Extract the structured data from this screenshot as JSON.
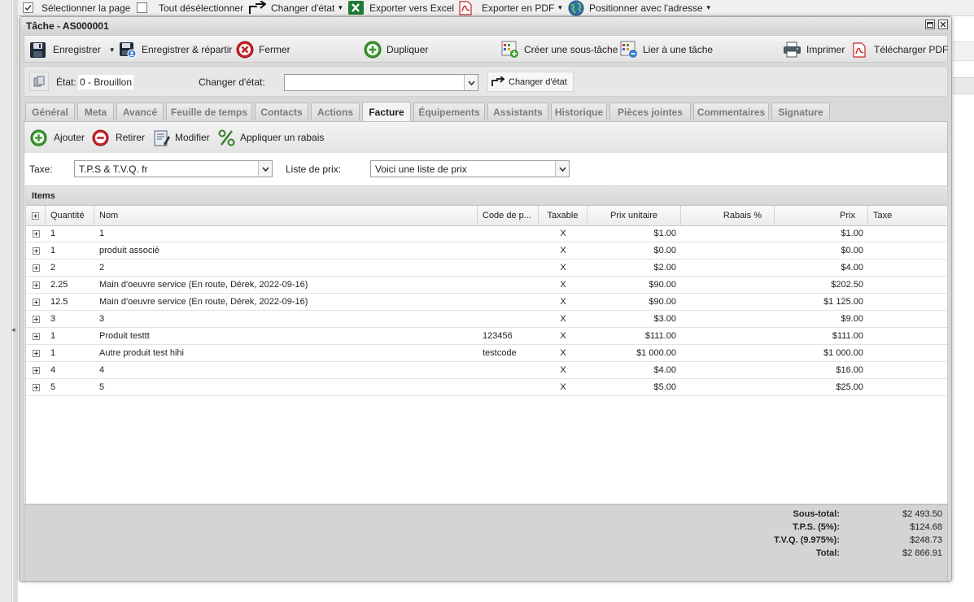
{
  "background_toolbar": {
    "select_page": "Sélectionner la page",
    "deselect_all": "Tout désélectionner",
    "change_state": "Changer d'état",
    "export_excel": "Exporter vers Excel",
    "export_pdf": "Exporter en PDF",
    "position_address": "Positionner avec l'adresse"
  },
  "window": {
    "title": "Tâche - AS000001"
  },
  "toolbar": {
    "save": "Enregistrer",
    "save_assign": "Enregistrer & répartir",
    "close": "Fermer",
    "duplicate": "Dupliquer",
    "create_subtask": "Créer une sous-tâche",
    "link_task": "Lier à une tâche",
    "print": "Imprimer",
    "download_pdf": "Télécharger PDF"
  },
  "state": {
    "label": "État:",
    "value": "0 - Brouillon",
    "change_label": "Changer d'état:",
    "change_value": "",
    "change_button": "Changer d'état"
  },
  "tabs": [
    {
      "label": "Général"
    },
    {
      "label": "Meta"
    },
    {
      "label": "Avancé"
    },
    {
      "label": "Feuille de temps"
    },
    {
      "label": "Contacts"
    },
    {
      "label": "Actions"
    },
    {
      "label": "Facture"
    },
    {
      "label": "Équipements"
    },
    {
      "label": "Assistants"
    },
    {
      "label": "Historique"
    },
    {
      "label": "Pièces jointes"
    },
    {
      "label": "Commentaires"
    },
    {
      "label": "Signature"
    }
  ],
  "active_tab": "Facture",
  "invoice_toolbar": {
    "add": "Ajouter",
    "remove": "Retirer",
    "edit": "Modifier",
    "discount": "Appliquer un rabais"
  },
  "tax": {
    "label": "Taxe:",
    "value": "T.P.S & T.V.Q. fr",
    "price_list_label": "Liste de prix:",
    "price_list_value": "Voici une liste de prix"
  },
  "grid": {
    "title": "Items",
    "columns": [
      "Quantité",
      "Nom",
      "Code de p...",
      "Taxable",
      "Prix unitaire",
      "Rabais %",
      "Prix",
      "Taxe"
    ],
    "rows": [
      {
        "qty": "1",
        "name": "1",
        "code": "",
        "taxable": "X",
        "unit": "$1.00",
        "discount": "",
        "price": "$1.00",
        "tax": ""
      },
      {
        "qty": "1",
        "name": "produit associé",
        "code": "",
        "taxable": "X",
        "unit": "$0.00",
        "discount": "",
        "price": "$0.00",
        "tax": ""
      },
      {
        "qty": "2",
        "name": "2",
        "code": "",
        "taxable": "X",
        "unit": "$2.00",
        "discount": "",
        "price": "$4.00",
        "tax": ""
      },
      {
        "qty": "2.25",
        "name": "Main d'oeuvre service (En route, Dérek, 2022-09-16)",
        "code": "",
        "taxable": "X",
        "unit": "$90.00",
        "discount": "",
        "price": "$202.50",
        "tax": ""
      },
      {
        "qty": "12.5",
        "name": "Main d'oeuvre service (En route, Dérek, 2022-09-16)",
        "code": "",
        "taxable": "X",
        "unit": "$90.00",
        "discount": "",
        "price": "$1 125.00",
        "tax": ""
      },
      {
        "qty": "3",
        "name": "3",
        "code": "",
        "taxable": "X",
        "unit": "$3.00",
        "discount": "",
        "price": "$9.00",
        "tax": ""
      },
      {
        "qty": "1",
        "name": "Produit testtt",
        "code": "123456",
        "taxable": "X",
        "unit": "$111.00",
        "discount": "",
        "price": "$111.00",
        "tax": ""
      },
      {
        "qty": "1",
        "name": "Autre produit test hihi",
        "code": "testcode",
        "taxable": "X",
        "unit": "$1 000.00",
        "discount": "",
        "price": "$1 000.00",
        "tax": ""
      },
      {
        "qty": "4",
        "name": "4",
        "code": "",
        "taxable": "X",
        "unit": "$4.00",
        "discount": "",
        "price": "$16.00",
        "tax": ""
      },
      {
        "qty": "5",
        "name": "5",
        "code": "",
        "taxable": "X",
        "unit": "$5.00",
        "discount": "",
        "price": "$25.00",
        "tax": ""
      }
    ]
  },
  "totals": [
    {
      "label": "Sous-total:",
      "value": "$2 493.50"
    },
    {
      "label": "T.P.S. (5%):",
      "value": "$124.68"
    },
    {
      "label": "T.V.Q. (9.975%):",
      "value": "$248.73"
    },
    {
      "label": "Total:",
      "value": "$2 866.91"
    }
  ],
  "icons": {
    "save": "floppy-icon",
    "close": "close-circle-icon",
    "duplicate": "plus-circle-icon",
    "print": "printer-icon",
    "pdf": "pdf-icon"
  },
  "colors": {
    "window_bg": "#d9d9d9",
    "panel_bg": "#f3f3f3",
    "add_green": "#3a9a2d",
    "remove_red": "#c8222a",
    "pdf_red": "#c62828"
  }
}
